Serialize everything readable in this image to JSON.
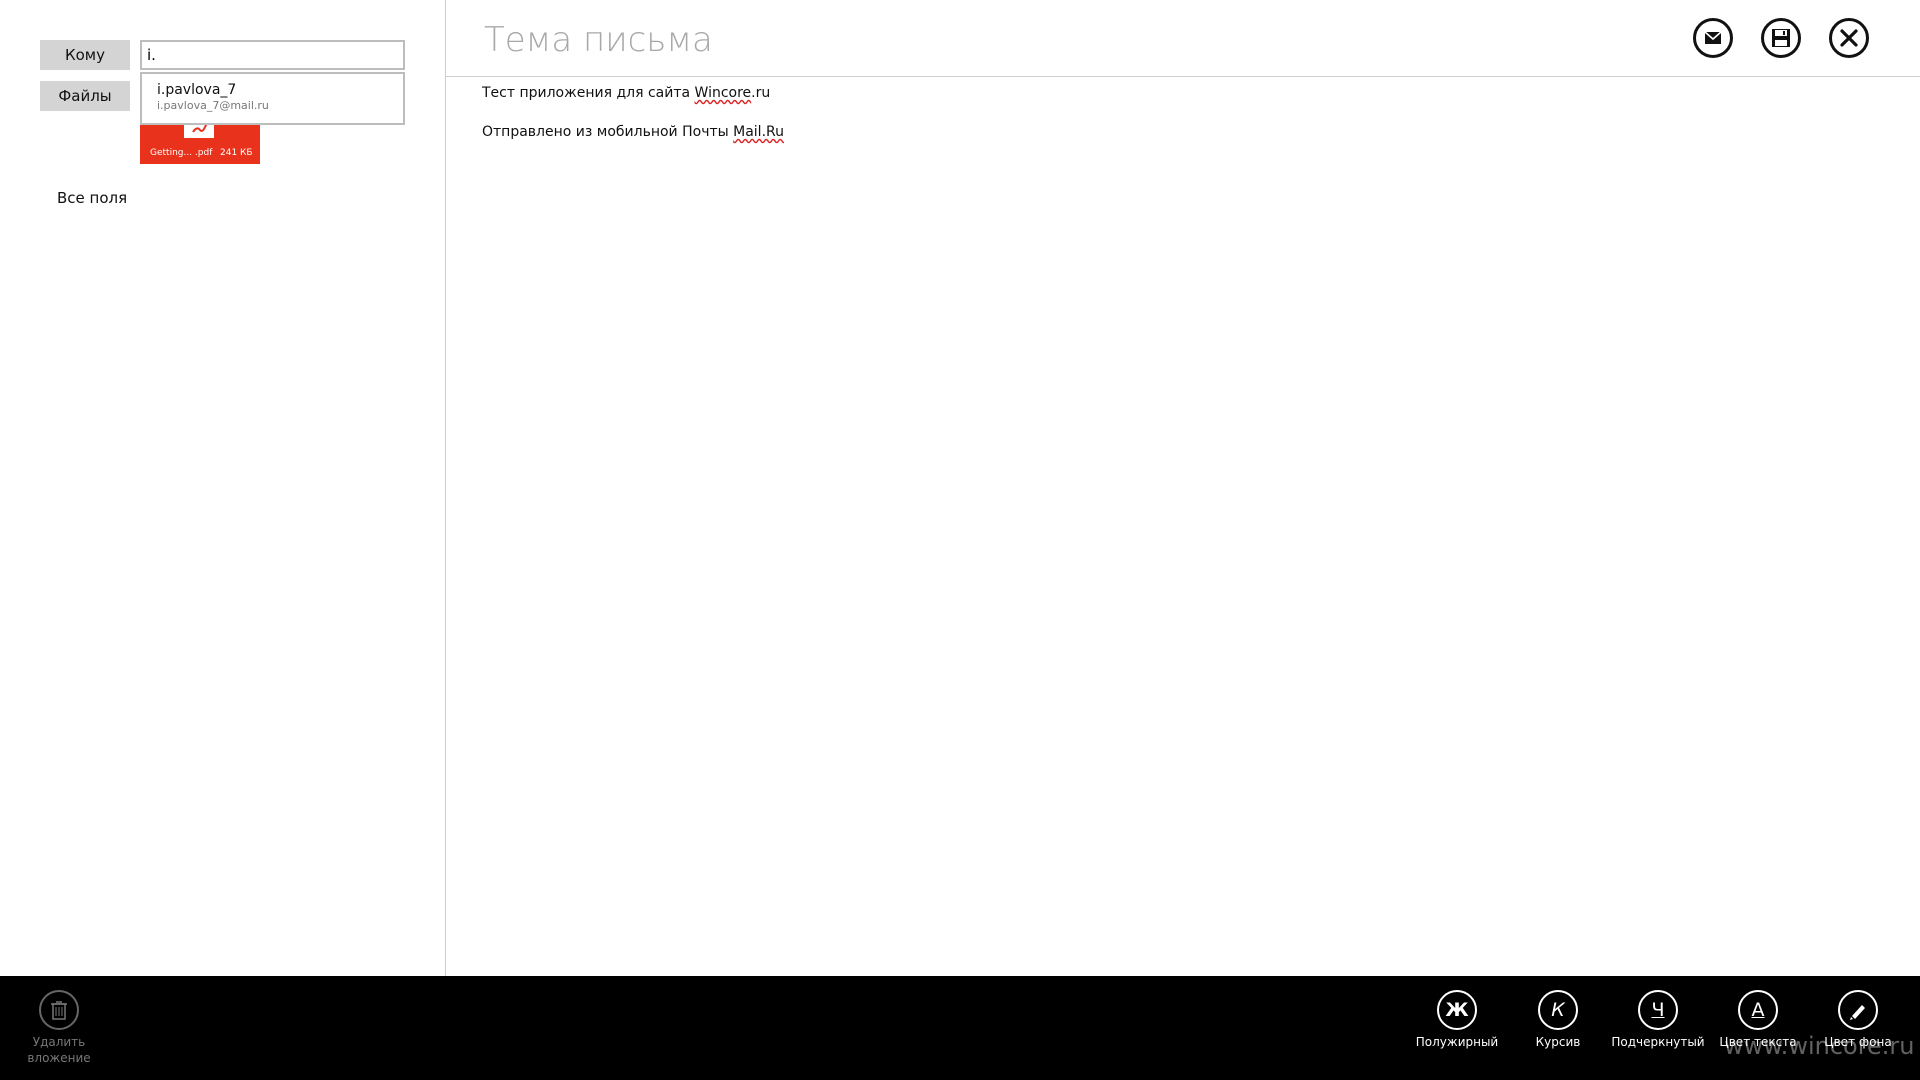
{
  "compose": {
    "to_label": "Кому",
    "files_label": "Файлы",
    "to_value": "i.",
    "suggestion": {
      "name": "i.pavlova_7",
      "email": "i.pavlova_7@mail.ru"
    },
    "attachment": {
      "name": "Getting... .pdf",
      "size": "241 КБ",
      "tile_color": "#e8321c"
    },
    "all_fields": "Все поля"
  },
  "message": {
    "subject_placeholder": "Тема письма",
    "body_line_1_prefix": "Тест приложения для сайта ",
    "body_line_1_link": "Wincore",
    "body_line_1_suffix": ".ru",
    "body_line_2_prefix": "Отправлено из мобильной Почты ",
    "body_line_2_link": "Mail.Ru"
  },
  "header_actions": {
    "send_icon": "envelope-icon",
    "save_icon": "floppy-disk-icon",
    "close_icon": "close-icon"
  },
  "app_bar": {
    "delete_attachment": "Удалить вложение",
    "bold": "Полужирный",
    "bold_glyph": "Ж",
    "italic": "Курсив",
    "italic_glyph": "К",
    "underline": "Подчеркнутый",
    "underline_glyph": "Ч",
    "text_color": "Цвет текста",
    "text_color_glyph": "А",
    "background_color": "Цвет фона"
  },
  "watermark": "www.wincore.ru",
  "colors": {
    "accent": "#e8321c",
    "app_bar": "#000000",
    "label_bg": "#d4d4d4"
  }
}
